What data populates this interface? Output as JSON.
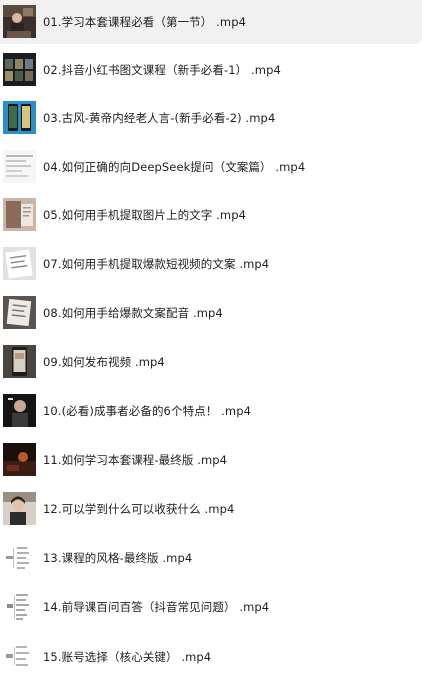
{
  "file_list": {
    "items": [
      {
        "name": "01.学习本套课程必看（第一节） .mp4",
        "thumbnail": "video-thumb-lecturer-icon",
        "selected": true
      },
      {
        "name": "02.抖音小红书图文课程（新手必看-1） .mp4",
        "thumbnail": "video-thumb-dark-grid-icon",
        "selected": false
      },
      {
        "name": "03.古风-黄帝内经老人言-(新手必看-2) .mp4",
        "thumbnail": "video-thumb-phone-screens-icon",
        "selected": false
      },
      {
        "name": "04.如何正确的向DeepSeek提问（文案篇） .mp4",
        "thumbnail": "video-thumb-document-icon",
        "selected": false
      },
      {
        "name": "05.如何用手机提取图片上的文字 .mp4",
        "thumbnail": "video-thumb-photo-hand-icon",
        "selected": false
      },
      {
        "name": "07.如何用手机提取爆款短视频的文案 .mp4",
        "thumbnail": "video-thumb-paper-icon",
        "selected": false
      },
      {
        "name": "08.如何用手给爆款文案配音 .mp4",
        "thumbnail": "video-thumb-paper-dark-icon",
        "selected": false
      },
      {
        "name": "09.如何发布视频 .mp4",
        "thumbnail": "video-thumb-phone-icon",
        "selected": false
      },
      {
        "name": "10.(必看)成事者必备的6个特点！ .mp4",
        "thumbnail": "video-thumb-portrait-dark-icon",
        "selected": false
      },
      {
        "name": "11.如何学习本套课程-最终版 .mp4",
        "thumbnail": "video-thumb-dark-scene-icon",
        "selected": false
      },
      {
        "name": "12.可以学到什么可以收获什么 .mp4",
        "thumbnail": "video-thumb-woman-icon",
        "selected": false
      },
      {
        "name": "13.课程的风格-最终版 .mp4",
        "thumbnail": "video-thumb-mindmap-icon",
        "selected": false
      },
      {
        "name": "14.前导课百问百答（抖音常见问题） .mp4",
        "thumbnail": "video-thumb-mindmap-icon",
        "selected": false
      },
      {
        "name": "15.账号选择（核心关键） .mp4",
        "thumbnail": "video-thumb-mindmap-icon",
        "selected": false
      }
    ]
  }
}
